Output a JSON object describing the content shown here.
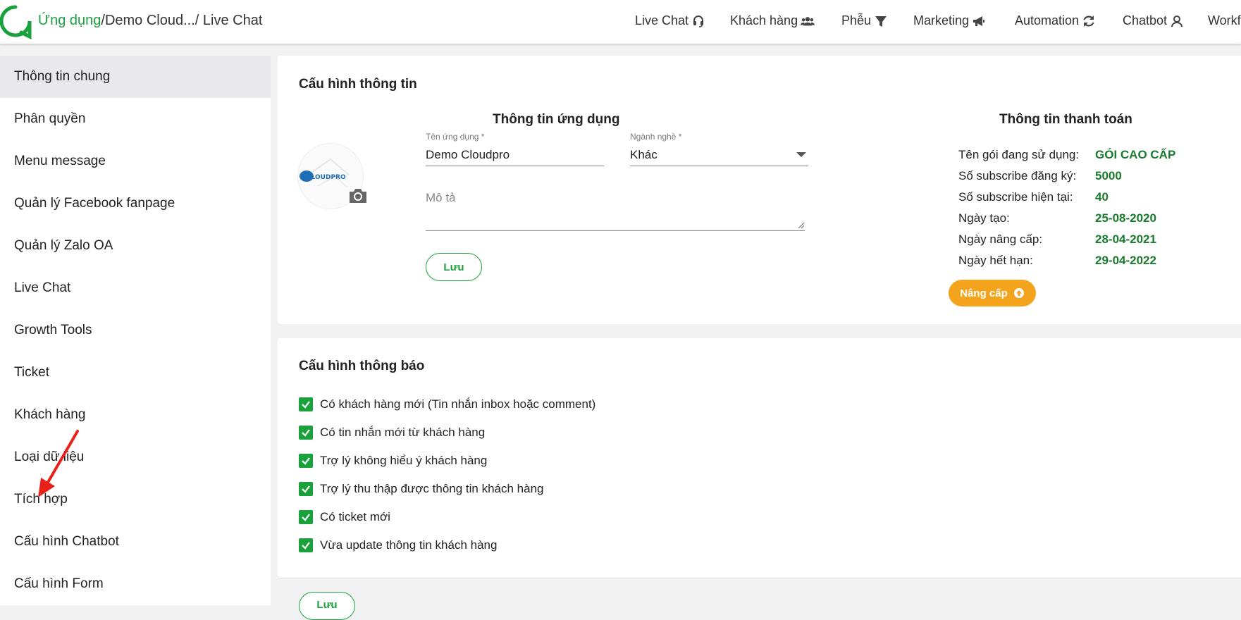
{
  "breadcrumb": {
    "app": "Ứng dụng",
    "sep": "/",
    "project": "Demo Cloud...",
    "page": "/ Live Chat"
  },
  "nav": [
    {
      "label": "Live Chat",
      "icon": "headset-icon"
    },
    {
      "label": "Khách hàng",
      "icon": "users-icon"
    },
    {
      "label": "Phễu",
      "icon": "filter-icon"
    },
    {
      "label": "Marketing",
      "icon": "megaphone-icon"
    },
    {
      "label": "Automation",
      "icon": "refresh-icon"
    },
    {
      "label": "Chatbot",
      "icon": "bot-icon"
    },
    {
      "label": "Workf",
      "icon": ""
    }
  ],
  "sidebar": {
    "items": [
      {
        "label": "Thông tin chung",
        "active": true
      },
      {
        "label": "Phân quyền"
      },
      {
        "label": "Menu message"
      },
      {
        "label": "Quản lý Facebook fanpage"
      },
      {
        "label": "Quản lý Zalo OA"
      },
      {
        "label": "Live Chat"
      },
      {
        "label": "Growth Tools"
      },
      {
        "label": "Ticket"
      },
      {
        "label": "Khách hàng"
      },
      {
        "label": "Loại dữ liệu"
      },
      {
        "label": "Tích hợp"
      },
      {
        "label": "Cấu hình Chatbot"
      },
      {
        "label": "Cấu hình Form"
      }
    ]
  },
  "config_info": {
    "title": "Cấu hình thông tin",
    "app_info_heading": "Thông tin ứng dụng",
    "logo_text": "CLOUDPRO",
    "app_name_label": "Tên ứng dụng *",
    "app_name_value": "Demo Cloudpro",
    "industry_label": "Ngành nghề *",
    "industry_value": "Khác",
    "description_placeholder": "Mô tả",
    "save_label": "Lưu"
  },
  "payment": {
    "heading": "Thông tin thanh toán",
    "rows": [
      {
        "label": "Tên gói đang sử dụng:",
        "value": "GÓI CAO CẤP"
      },
      {
        "label": "Số subscribe đăng ký:",
        "value": "5000"
      },
      {
        "label": "Số subscribe hiện tại:",
        "value": "40"
      },
      {
        "label": "Ngày tạo:",
        "value": "25-08-2020"
      },
      {
        "label": "Ngày nâng cấp:",
        "value": "28-04-2021"
      },
      {
        "label": "Ngày hết hạn:",
        "value": "29-04-2022"
      }
    ],
    "upgrade_label": "Nâng cấp"
  },
  "notifications": {
    "title": "Cấu hình thông báo",
    "items": [
      {
        "label": "Có khách hàng mới (Tin nhắn inbox hoặc comment)",
        "checked": true
      },
      {
        "label": "Có tin nhắn mới từ khách hàng",
        "checked": true
      },
      {
        "label": "Trợ lý không hiểu ý khách hàng",
        "checked": true
      },
      {
        "label": "Trợ lý thu thập được thông tin khách hàng",
        "checked": true
      },
      {
        "label": "Có ticket mới",
        "checked": true
      },
      {
        "label": "Vừa update thông tin khách hàng",
        "checked": true
      }
    ],
    "save_label": "Lưu"
  },
  "colors": {
    "brand_green": "#1aa13d",
    "value_green": "#1a7a2e",
    "upgrade_orange": "#f4a41c",
    "annotation_red": "#e8201a"
  }
}
